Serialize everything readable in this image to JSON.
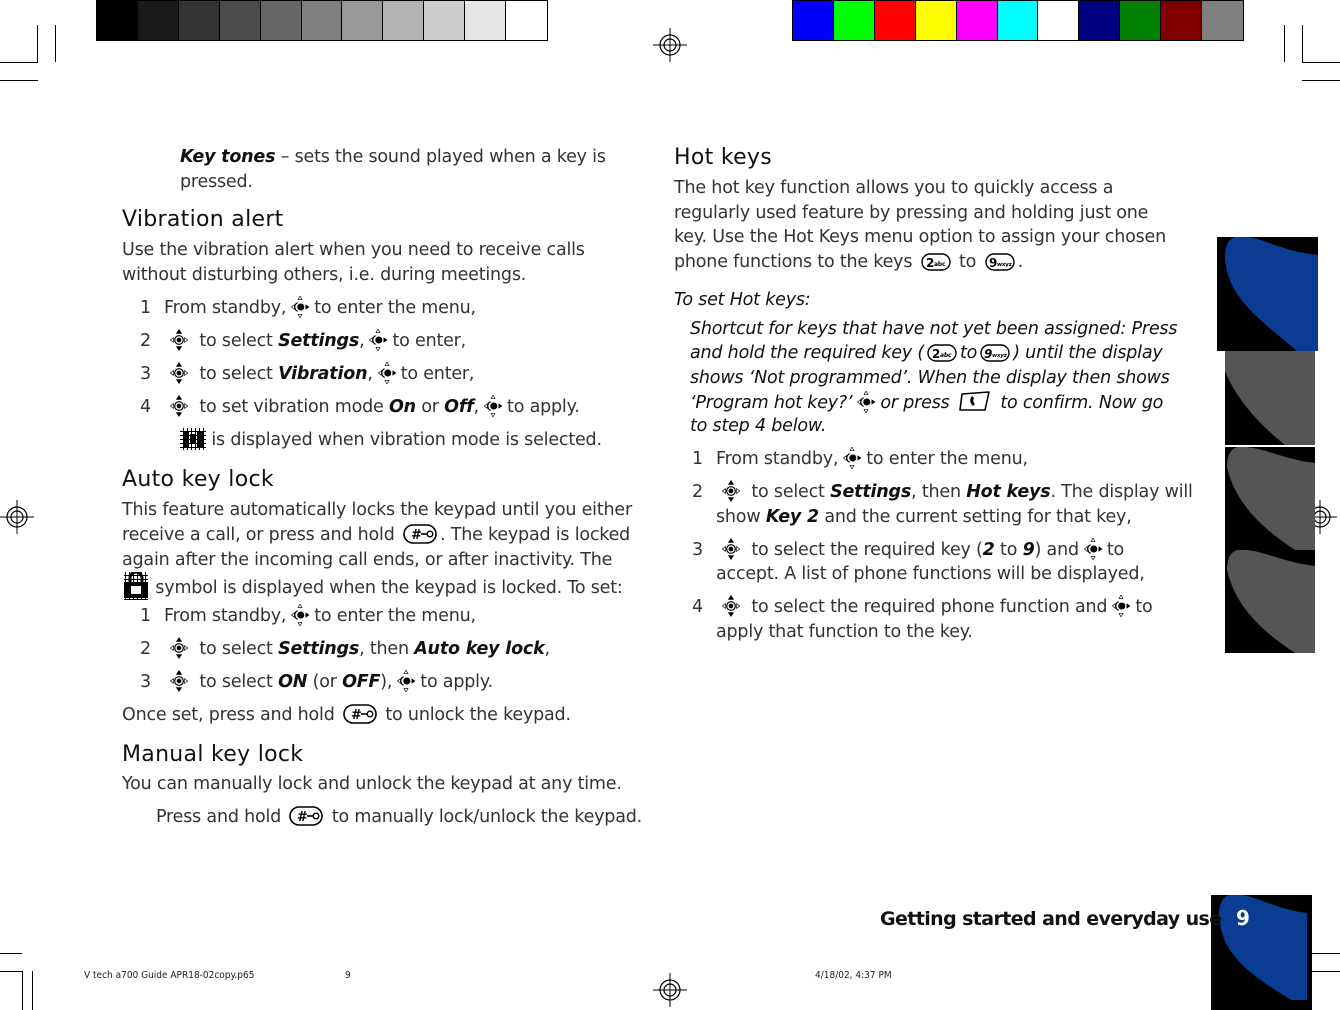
{
  "color_bars": {
    "grayscale": [
      "#000000",
      "#1a1a1a",
      "#333333",
      "#4d4d4d",
      "#666666",
      "#808080",
      "#999999",
      "#b3b3b3",
      "#cccccc",
      "#e6e6e6",
      "#ffffff"
    ],
    "process": [
      "#0000ff",
      "#00ff00",
      "#ff0000",
      "#ffff00",
      "#ff00ff",
      "#00ffff",
      "#ffffff",
      "#000080",
      "#008000",
      "#800000",
      "#808080"
    ]
  },
  "left_column": {
    "key_tones_term": "Key tones",
    "key_tones_dash": " – ",
    "key_tones_desc_1": "sets the sound played when a key is",
    "key_tones_desc_2": "pressed.",
    "vibration": {
      "heading": "Vibration alert",
      "intro_1": "Use the vibration alert when you need to receive calls",
      "intro_2": "without disturbing others, i.e. during meetings.",
      "steps": [
        {
          "num": "1",
          "pre": "From standby,",
          "post": "to enter the menu,"
        },
        {
          "num": "2",
          "pre": "to select",
          "term": "Settings",
          "mid": ",",
          "post": "to enter,"
        },
        {
          "num": "3",
          "pre": "to select",
          "term": "Vibration",
          "mid": ",",
          "post": "to enter,"
        },
        {
          "num": "4",
          "pre": "to set vibration mode",
          "term": "On",
          "or": "or",
          "term2": "Off",
          "mid": ",",
          "post": "to apply."
        }
      ],
      "note": "is displayed when vibration mode is selected."
    },
    "auto_lock": {
      "heading": "Auto key lock",
      "intro_1": "This feature automatically locks the keypad until you either",
      "intro_2a": "receive a call, or press and hold",
      "intro_2b": ". The keypad is locked",
      "intro_3": "again after the incoming call ends, or after inactivity. The",
      "intro_4": "symbol is displayed when the keypad is locked. To set:",
      "steps": [
        {
          "num": "1",
          "pre": "From standby,",
          "post": "to enter the menu,"
        },
        {
          "num": "2",
          "pre": "to select",
          "term": "Settings",
          "mid": ", then",
          "term2": "Auto key lock",
          "post": ","
        },
        {
          "num": "3",
          "pre": "to select",
          "term": "ON",
          "mid": "(or",
          "term2": "OFF",
          "post": "),",
          "post2": "to apply."
        }
      ],
      "once_a": "Once set, press and hold",
      "once_b": "to unlock the keypad."
    },
    "manual_lock": {
      "heading": "Manual key lock",
      "intro": "You can manually lock and unlock the keypad at any time.",
      "press_a": "Press and hold",
      "press_b": "to manually lock/unlock the keypad."
    }
  },
  "right_column": {
    "heading": "Hot keys",
    "intro_1": "The hot key function allows you to quickly access a",
    "intro_2": "regularly used feature by pressing and holding just one",
    "intro_3": "key. Use the Hot Keys menu option to assign your chosen",
    "intro_4a": "phone functions to the keys",
    "intro_4b": "to",
    "intro_4c": ".",
    "key_2": "2abc",
    "key_9": "9wxyz",
    "to_set": "To set Hot keys:",
    "shortcut_1": "Shortcut for keys that have not yet been assigned: Press",
    "shortcut_2a": "and hold the required key (",
    "shortcut_2b": "to",
    "shortcut_2c": ") until the display",
    "shortcut_3": "shows ‘Not programmed’. When the display then shows",
    "shortcut_4a": "‘Program hot key?’",
    "shortcut_4b": "or press",
    "shortcut_4c": "to confirm. Now go",
    "shortcut_5": "to step 4 below.",
    "steps": [
      {
        "num": "1",
        "line1_pre": "From standby,",
        "line1_post": "to enter the menu,"
      },
      {
        "num": "2",
        "line1_pre": "to select",
        "term": "Settings",
        "mid": ", then",
        "term2": "Hot keys",
        "line1_post": ". The display will",
        "line2_pre": "show",
        "term3": "Key 2",
        "line2_post": "and the current setting for that key,"
      },
      {
        "num": "3",
        "line1_pre": "to select the required key (",
        "term": "2",
        "mid": "to",
        "term2": "9",
        "line1_post": ") and",
        "line1_end": "to",
        "line2": "accept. A list of phone functions will be displayed,"
      },
      {
        "num": "4",
        "line1_pre": "to select the required phone function and",
        "line1_end": "to",
        "line2": "apply that function to the key."
      }
    ]
  },
  "footer": {
    "section_title": "Getting started and everyday use",
    "page_number": "9",
    "slug_file": "V tech a700 Guide APR18-02copy.p65",
    "slug_page": "9",
    "slug_date": "4/18/02, 4:37 PM"
  },
  "tab_colors": {
    "active": "#0a3d91",
    "inactive": "#555555"
  }
}
